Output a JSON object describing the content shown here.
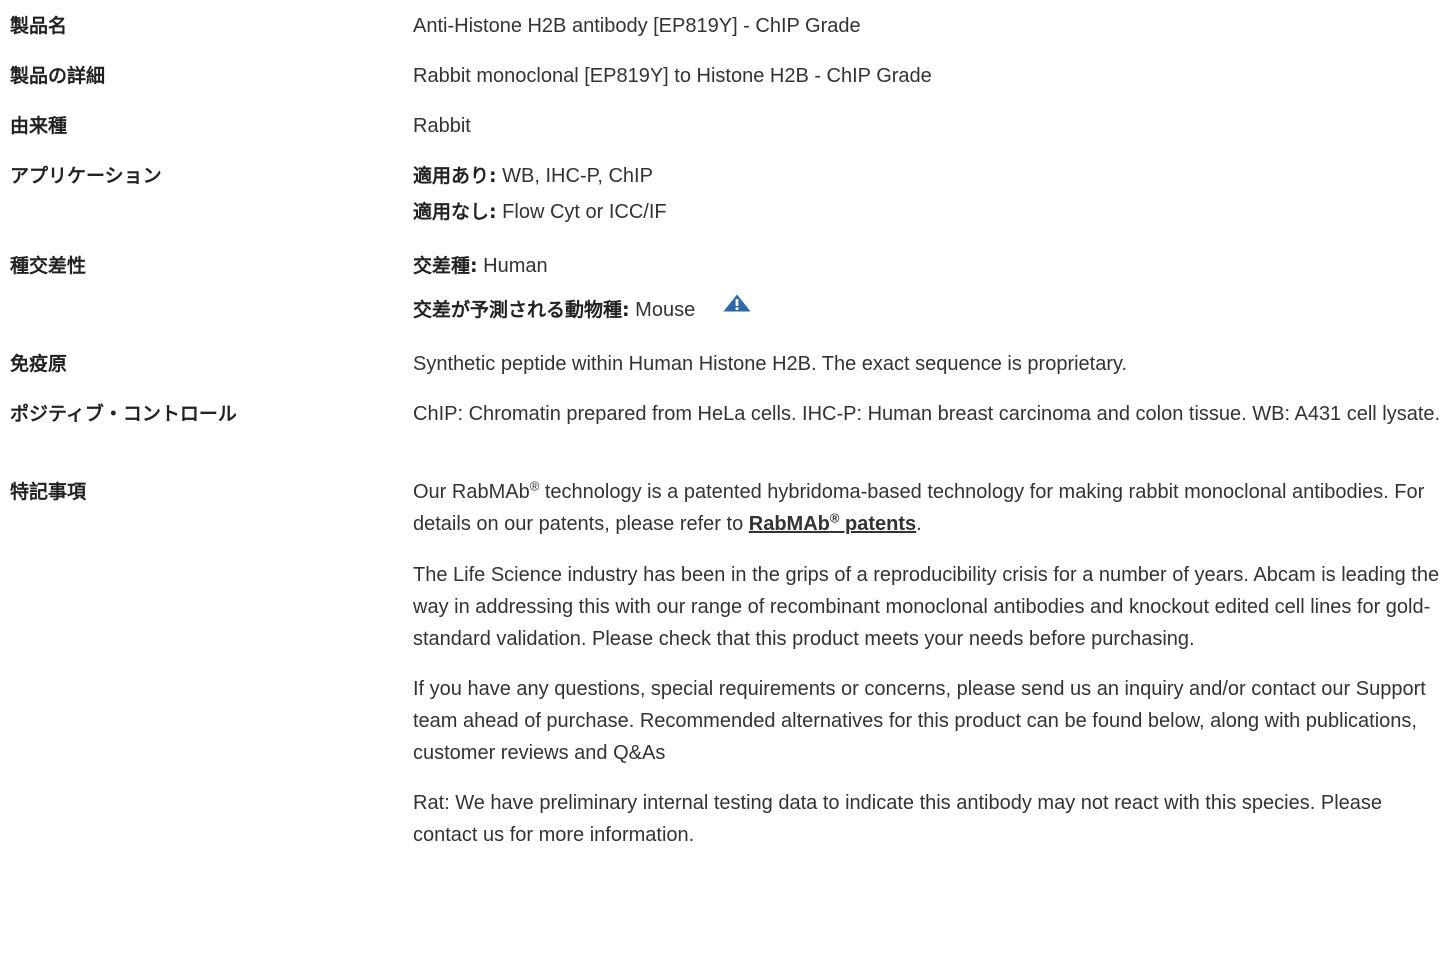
{
  "product_name": {
    "label": "製品名",
    "value": "Anti-Histone H2B antibody [EP819Y] - ChIP Grade"
  },
  "product_details": {
    "label": "製品の詳細",
    "value": "Rabbit monoclonal [EP819Y] to Histone H2B - ChIP Grade"
  },
  "host_species": {
    "label": "由来種",
    "value": "Rabbit"
  },
  "applications": {
    "label": "アプリケーション",
    "suitable_label": "適用あり:",
    "suitable_value": "WB, IHC-P, ChIP",
    "unsuitable_label": "適用なし:",
    "unsuitable_value": "Flow Cyt or ICC/IF"
  },
  "species_reactivity": {
    "label": "種交差性",
    "reacts_label": "交差種:",
    "reacts_value": "Human",
    "predicted_label": "交差が予測される動物種:",
    "predicted_value": "Mouse",
    "predicted_icon": "warning-triangle-icon",
    "icon_color": "#2a6aa9"
  },
  "immunogen": {
    "label": "免疫原",
    "value": "Synthetic peptide within Human Histone H2B. The exact sequence is proprietary."
  },
  "positive_control": {
    "label": "ポジティブ・コントロール",
    "value": "ChIP: Chromatin prepared from HeLa cells. IHC-P: Human breast carcinoma and colon tissue. WB: A431 cell lysate."
  },
  "general_notes": {
    "label": "特記事項",
    "p1_before": "Our RabMAb",
    "p1_reg": "®",
    "p1_middle": " technology is a patented hybridoma-based technology for making rabbit monoclonal antibodies. For details on our patents, please refer to ",
    "p1_link_text": "RabMAb",
    "p1_link_reg": "®",
    "p1_link_suffix": " patents",
    "p1_end": ".",
    "p2": "The Life Science industry has been in the grips of a reproducibility crisis for a number of years. Abcam is leading the way in addressing this with our range of recombinant monoclonal antibodies and knockout edited cell lines for gold-standard validation. Please check that this product meets your needs before purchasing.",
    "p3": "If you have any questions, special requirements or concerns, please send us an inquiry and/or contact our Support team ahead of purchase. Recommended alternatives for this product can be found below, along with publications, customer reviews and Q&As",
    "p4": "Rat: We have preliminary internal testing data to indicate this antibody may not react with this species. Please contact us for more information."
  },
  "colors": {
    "text": "#333333",
    "label": "#222222",
    "icon": "#2a6aa9"
  }
}
